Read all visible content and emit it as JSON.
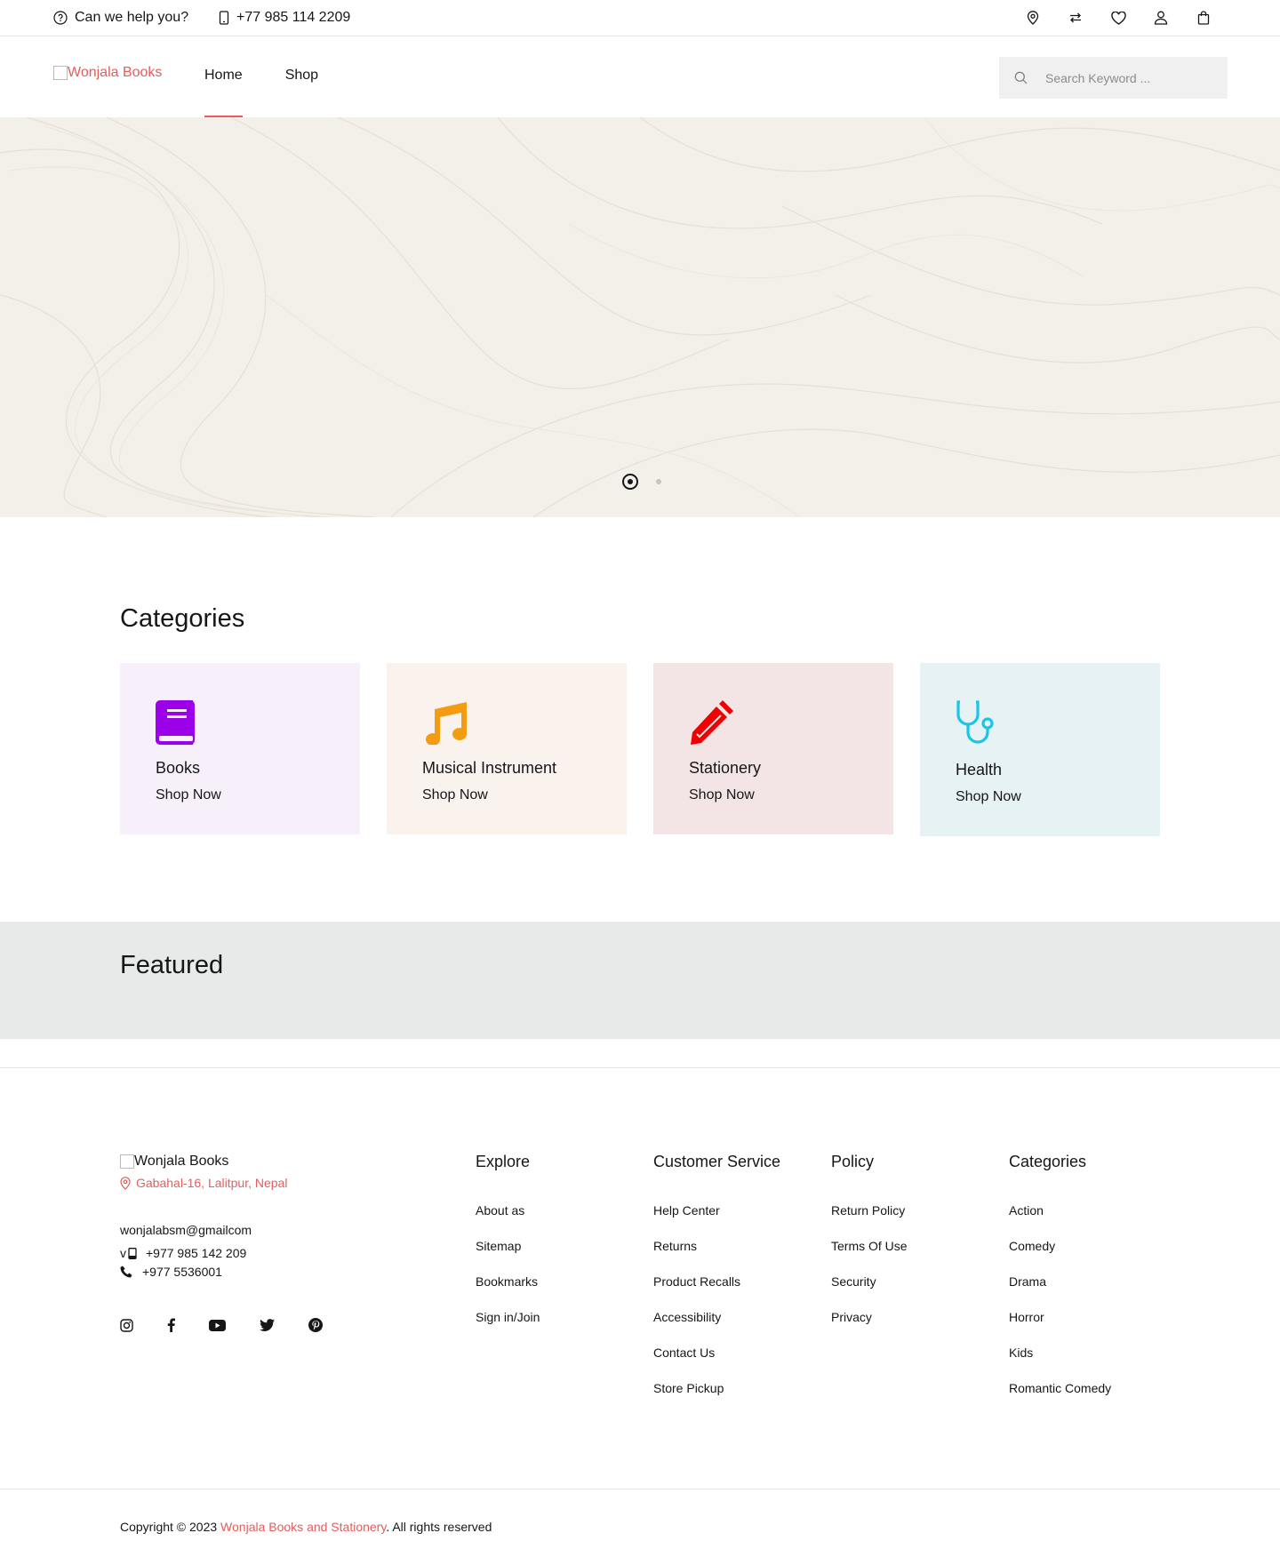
{
  "topbar": {
    "help_text": "Can we help you?",
    "phone": "+77 985 114 2209",
    "icons": [
      "location-icon",
      "compare-icon",
      "heart-icon",
      "user-icon",
      "bag-icon"
    ]
  },
  "header": {
    "logo_alt": "Wonjala Books",
    "nav": [
      {
        "label": "Home",
        "active": true
      },
      {
        "label": "Shop",
        "active": false
      }
    ],
    "search_placeholder": "Search Keyword ..."
  },
  "hero": {
    "slides_count": 2,
    "active_slide": 1
  },
  "categories": {
    "title": "Categories",
    "items": [
      {
        "name": "Books",
        "cta": "Shop Now",
        "icon": "book-icon",
        "bg": "#f7f0fb",
        "color": "#9b00e8"
      },
      {
        "name": "Musical Instrument",
        "cta": "Shop Now",
        "icon": "music-note-icon",
        "bg": "#faf2ec",
        "color": "#f39c12"
      },
      {
        "name": "Stationery",
        "cta": "Shop Now",
        "icon": "pencil-icon",
        "bg": "#f3e5e5",
        "color": "#f00000"
      },
      {
        "name": "Health",
        "cta": "Shop Now",
        "icon": "stethoscope-icon",
        "bg": "#e6f2f4",
        "color": "#1cc4e6"
      }
    ]
  },
  "featured": {
    "title": "Featured"
  },
  "footer": {
    "logo_alt": "Wonjala Books",
    "address": "Gabahal-16, Lalitpur, Nepal",
    "email": "wonjalabsm@gmailcom",
    "mobile_prefix": "v",
    "mobile": "+977 985 142 209",
    "telephone": "+977 5536001",
    "social": [
      "instagram-icon",
      "facebook-icon",
      "youtube-icon",
      "twitter-icon",
      "pinterest-icon"
    ],
    "columns": [
      {
        "title": "Explore",
        "links": [
          "About as",
          "Sitemap",
          "Bookmarks",
          "Sign in/Join"
        ]
      },
      {
        "title": "Customer Service",
        "links": [
          "Help Center",
          "Returns",
          "Product Recalls",
          "Accessibility",
          "Contact Us",
          "Store Pickup"
        ]
      },
      {
        "title": "Policy",
        "links": [
          "Return Policy",
          "Terms Of Use",
          "Security",
          "Privacy"
        ]
      },
      {
        "title": "Categories",
        "links": [
          "Action",
          "Comedy",
          "Drama",
          "Horror",
          "Kids",
          "Romantic Comedy"
        ]
      }
    ],
    "copyright_prefix": "Copyright © 2023 ",
    "copyright_brand": "Wonjala Books and Stationery",
    "copyright_suffix": ". All rights reserved"
  },
  "colors": {
    "accent": "#e35e5e",
    "hero_bg": "#f3efe9",
    "featured_bg": "#e8e9e9"
  }
}
